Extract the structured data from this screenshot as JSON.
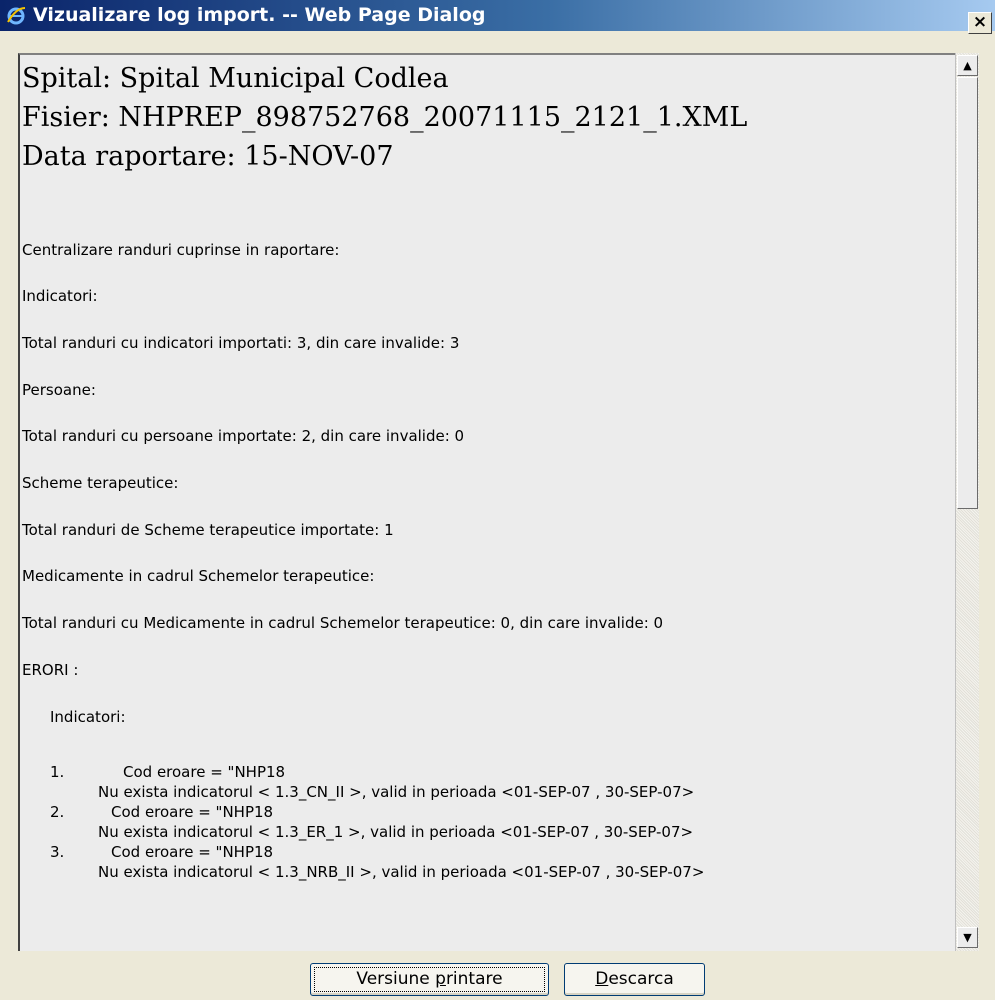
{
  "window": {
    "title": "Vizualizare log import. -- Web Page Dialog",
    "close_glyph": "×"
  },
  "header": {
    "spital": "Spital: Spital Municipal Codlea",
    "fisier": "Fisier: NHPREP_898752768_20071115_2121_1.XML",
    "data": "Data raportare: 15-NOV-07"
  },
  "summary": {
    "centralizare": "Centralizare randuri cuprinse in raportare:",
    "indicatori_label": "Indicatori:",
    "indicatori_total": "Total randuri cu indicatori importati: 3, din care invalide: 3",
    "persoane_label": "Persoane:",
    "persoane_total": "Total randuri cu persoane importate: 2, din care invalide: 0",
    "scheme_label": "Scheme terapeutice:",
    "scheme_total": "Total randuri de Scheme terapeutice importate: 1",
    "medicamente_label": "Medicamente in cadrul Schemelor terapeutice:",
    "medicamente_total": "Total randuri cu Medicamente in cadrul Schemelor terapeutice: 0, din care invalide: 0",
    "erori_label": "ERORI :",
    "erori_indicatori": "Indicatori:"
  },
  "errors": [
    {
      "num": "1.",
      "code": "Cod eroare = \"NHP18",
      "message": "Nu exista indicatorul < 1.3_CN_II >, valid in perioada <01-SEP-07 , 30-SEP-07>"
    },
    {
      "num": "2.",
      "code": "Cod eroare = \"NHP18",
      "message": "Nu exista indicatorul < 1.3_ER_1 >, valid in perioada <01-SEP-07 , 30-SEP-07>"
    },
    {
      "num": "3.",
      "code": "Cod eroare = \"NHP18",
      "message": "Nu exista indicatorul < 1.3_NRB_II >, valid in perioada <01-SEP-07 , 30-SEP-07>"
    }
  ],
  "scrollbar": {
    "up_glyph": "▲",
    "down_glyph": "▼"
  },
  "buttons": {
    "print_before": "Versiune ",
    "print_hotkey": "p",
    "print_after": "rintare",
    "download_hotkey": "D",
    "download_after": "escarca"
  }
}
